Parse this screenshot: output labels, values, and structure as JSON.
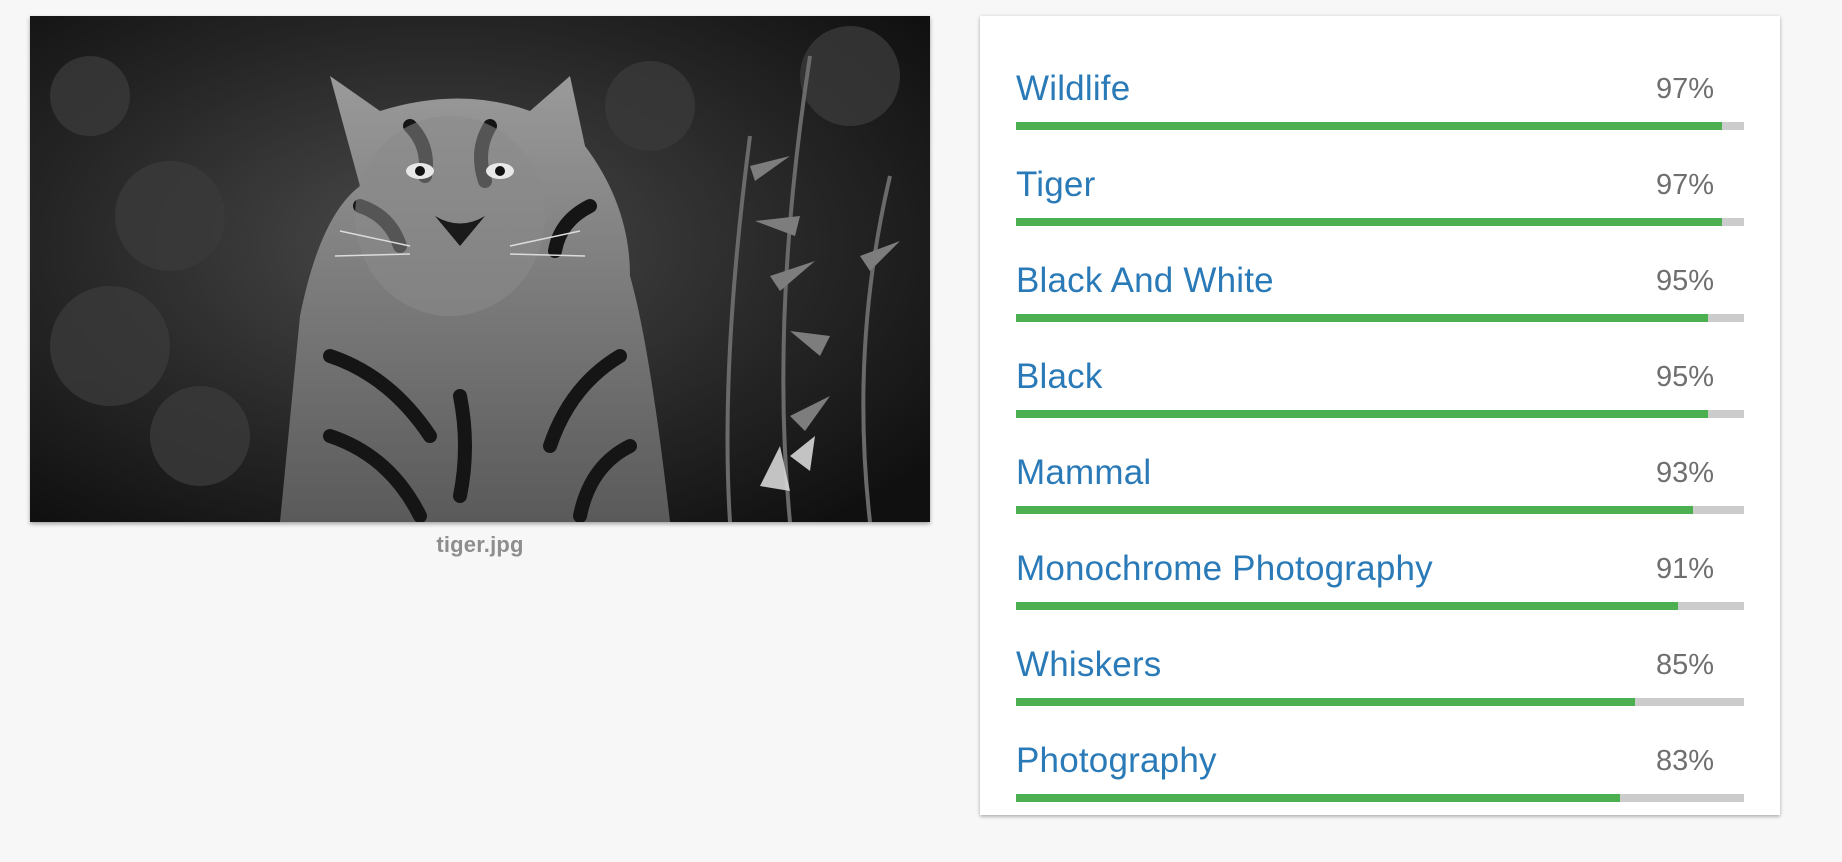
{
  "image": {
    "filename": "tiger.jpg"
  },
  "colors": {
    "label_text": "#2a7ab8",
    "bar_fill": "#4caf50",
    "bar_track": "#cccccc",
    "percent_text": "#6f6f6f"
  },
  "labels": [
    {
      "name": "Wildlife",
      "percent": "97%",
      "score": 0.97
    },
    {
      "name": "Tiger",
      "percent": "97%",
      "score": 0.97
    },
    {
      "name": "Black And White",
      "percent": "95%",
      "score": 0.95
    },
    {
      "name": "Black",
      "percent": "95%",
      "score": 0.95
    },
    {
      "name": "Mammal",
      "percent": "93%",
      "score": 0.93
    },
    {
      "name": "Monochrome Photography",
      "percent": "91%",
      "score": 0.91
    },
    {
      "name": "Whiskers",
      "percent": "85%",
      "score": 0.85
    },
    {
      "name": "Photography",
      "percent": "83%",
      "score": 0.83
    }
  ]
}
